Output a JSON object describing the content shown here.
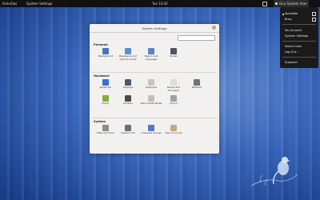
{
  "topbar": {
    "activities": "Activities",
    "app_menu": "System Settings",
    "clock": "Tue 14:42",
    "user_name": "Gnu System User"
  },
  "user_menu": {
    "available": "Available",
    "busy": "Busy",
    "my_account": "My Account",
    "system_settings": "System Settings",
    "switch_user": "Switch User",
    "log_out": "Log Out...",
    "suspend": "Suspend"
  },
  "window": {
    "title": "System Settings",
    "close_glyph": "×",
    "sections": [
      {
        "name": "Personal",
        "items": [
          {
            "label": "Background",
            "icon": "background-icon",
            "color": "#4a76c0"
          },
          {
            "label": "Messaging and VoIP Accounts",
            "icon": "messaging-icon",
            "color": "#5d8ed2"
          },
          {
            "label": "Region and Language",
            "icon": "region-icon",
            "color": "#5b84c8"
          },
          {
            "label": "Screen",
            "icon": "screen-icon",
            "color": "#4d5563"
          }
        ]
      },
      {
        "name": "Hardware",
        "items": [
          {
            "label": "Bluetooth",
            "icon": "bluetooth-icon",
            "color": "#3b6fcf"
          },
          {
            "label": "Displays",
            "icon": "displays-icon",
            "color": "#4e5866"
          },
          {
            "label": "Keyboard",
            "icon": "keyboard-icon",
            "color": "#c4c4c4"
          },
          {
            "label": "Mouse and Touchpad",
            "icon": "mouse-icon",
            "color": "#dcdcdc"
          },
          {
            "label": "Network",
            "icon": "network-icon",
            "color": "#6e747c"
          },
          {
            "label": "Power",
            "icon": "power-icon",
            "color": "#7fae3e"
          },
          {
            "label": "Printers",
            "icon": "printers-icon",
            "color": "#4c4c4c"
          },
          {
            "label": "Removable Media",
            "icon": "removable-media-icon",
            "color": "#bfbfbf"
          },
          {
            "label": "Sound",
            "icon": "sound-icon",
            "color": "#9aa1aa"
          }
        ]
      },
      {
        "name": "System",
        "items": [
          {
            "label": "Date and Time",
            "icon": "date-time-icon",
            "color": "#8c8c8c"
          },
          {
            "label": "System Info",
            "icon": "system-info-icon",
            "color": "#6a6f78"
          },
          {
            "label": "Universal Access",
            "icon": "universal-access-icon",
            "color": "#5577c4"
          },
          {
            "label": "User Accounts",
            "icon": "user-accounts-icon",
            "color": "#c9a77c"
          }
        ]
      }
    ]
  }
}
